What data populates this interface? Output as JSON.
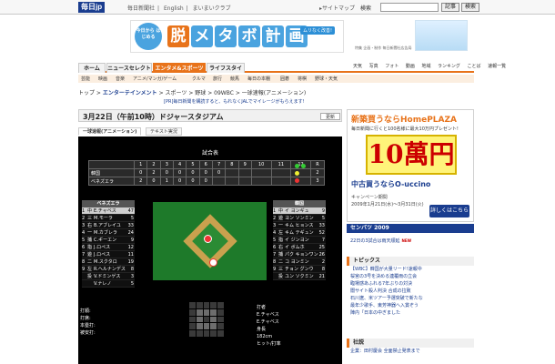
{
  "header": {
    "logo": "毎日jp",
    "links": [
      "毎日新聞社",
      "English",
      "まいまいクラブ"
    ],
    "sitemap": "▸サイトマップ",
    "search_label": "検索",
    "search_value": "",
    "btn_article": "記事",
    "btn_web": "検索"
  },
  "banner": {
    "circle_text": "今日から はじめる",
    "title_chars": [
      "脱",
      "メ",
      "タ",
      "ボ",
      "計",
      "画"
    ],
    "title_colors": [
      "#e8731a",
      "#4aa3df",
      "#4aa3df",
      "#4aa3df",
      "#4aa3df",
      "#4aa3df"
    ],
    "note": "ムリなく改善!",
    "credit": "特集 企画・制作 毎日新聞社広告局"
  },
  "nav": {
    "tabs": [
      "ホーム",
      "ニュースセレクト",
      "エンタメ&スポーツ",
      "ライフスタイル"
    ],
    "right_links": [
      "天気",
      "写真",
      "フォト",
      "動画",
      "地域",
      "ランキング",
      "ことば",
      "速報一覧"
    ],
    "categories": [
      "芸能",
      "映画",
      "音楽",
      "アニメ/マンガ/ゲーム",
      "クルマ",
      "旅行",
      "競馬",
      "毎日の本棚",
      "囲碁",
      "将棋",
      "野球・天気"
    ]
  },
  "breadcrumb": {
    "parts": [
      "トップ",
      "エンターテインメント",
      "スポーツ",
      "野球",
      "09WBC",
      "一球速報(アニメーション)"
    ],
    "promo": "[PR]毎日新聞を購読すると、もれなくJALでマイレージがもらえます!"
  },
  "game": {
    "headline": "3月22日（午前10時）ドジャースタジアム",
    "refresh": "更新",
    "subtabs": [
      "一球速報(アニメーション)",
      "テキスト実況"
    ],
    "title": "試合表",
    "score_head": [
      "",
      "1",
      "2",
      "3",
      "4",
      "5",
      "6",
      "7",
      "8",
      "9",
      "10",
      "11",
      "12",
      "R"
    ],
    "score_rows": [
      {
        "team": "韓国",
        "cells": [
          "0",
          "2",
          "0",
          "0",
          "0",
          "0",
          "0",
          "",
          "",
          "",
          "",
          "",
          "2"
        ]
      },
      {
        "team": "ベネズエラ",
        "cells": [
          "2",
          "0",
          "1",
          "0",
          "0",
          "0",
          "",
          "",
          "",
          "",
          "",
          "",
          "3"
        ]
      }
    ],
    "away_lineup": {
      "name": "ベネズエラ",
      "rows": [
        [
          "1",
          "中",
          "E.チャベス",
          "47"
        ],
        [
          "2",
          "三",
          "M.モーラ",
          "5"
        ],
        [
          "3",
          "右",
          "B.アブレイユ",
          "33"
        ],
        [
          "4",
          "一",
          "M.カブレラ",
          "24"
        ],
        [
          "5",
          "捕",
          "C.ギーエン",
          "9"
        ],
        [
          "6",
          "指",
          "J.ロペス",
          "12"
        ],
        [
          "7",
          "遊",
          "J.ロペス",
          "11"
        ],
        [
          "8",
          "二",
          "M.スクタロ",
          "19"
        ],
        [
          "9",
          "左",
          "R.ヘルナンデス",
          "8"
        ],
        [
          "",
          "投",
          "V.ドミンゲス",
          "3"
        ],
        [
          "",
          "",
          "V.ナレノ",
          "5"
        ]
      ]
    },
    "home_lineup": {
      "name": "韓国",
      "rows": [
        [
          "1",
          "中",
          "イ ヨンギュ",
          "9"
        ],
        [
          "2",
          "遊",
          "ヨン ソンミン",
          "5"
        ],
        [
          "3",
          "一",
          "キム ヒョンス",
          "33"
        ],
        [
          "4",
          "左",
          "キム テギュン",
          "52"
        ],
        [
          "5",
          "指",
          "イ ジンヨン",
          "7"
        ],
        [
          "6",
          "右",
          "イ ボムホ",
          "25"
        ],
        [
          "7",
          "捕",
          "パク キョンワン",
          "26"
        ],
        [
          "8",
          "二",
          "コ ヨンミン",
          "2"
        ],
        [
          "9",
          "三",
          "チョン グンウ",
          "8"
        ],
        [
          "",
          "投",
          "ユン ソクミン",
          "21"
        ]
      ]
    },
    "bottom_labels": [
      "打順:",
      "打席:",
      "本塁打:",
      "被安打:"
    ],
    "batter_info": [
      "打者",
      "E.チャベス",
      "E.チャベス",
      "身長",
      "182cm",
      "ヒット/打率"
    ]
  },
  "ad": {
    "title": "新築買うならHomePLAZA",
    "sub": "毎日新聞に行くと100名様に最大10万円プレゼント!",
    "big": "10萬円",
    "brand": "中古買うならO-uccino",
    "line1": "キャンペーン期間",
    "line2": "2009年1月21日(水)〜3月31日(火)",
    "btn": "詳しくはこちら"
  },
  "sidebar": {
    "senbatsu_head": "センバツ 2009",
    "senbatsu_items": [
      "22日の3試合は雨天順延"
    ],
    "topics_head": "トピックス",
    "topics_items": [
      "【WBC】韓国が大量リード!速報中",
      "桜宮の3号を決める連覆雨の立会",
      "臨場感あふれる7年ぶりの対決",
      "闇サイト殺人判決 合成の拉致",
      "石川遼、米ツアー予選突破で新たな",
      "最年少歌手、東芳神器へ入賞ぞう",
      "陣内「日本の中ぎました"
    ],
    "social_head": "社説",
    "social_items": [
      "企業：田村慶会 全面禁止発表まで"
    ]
  },
  "colors": {
    "brand_blue": "#1a3d8f",
    "accent_orange": "#e8731a"
  }
}
